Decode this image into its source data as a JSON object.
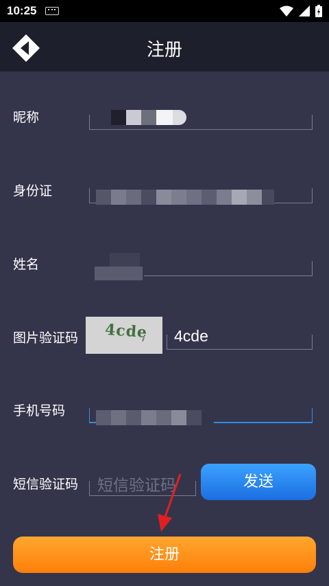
{
  "status_bar": {
    "time": "10:25",
    "icons": [
      "keyboard-icon",
      "wifi-icon",
      "signal-icon",
      "battery-icon"
    ]
  },
  "header": {
    "title": "注册",
    "back_icon": "back-arrow-icon"
  },
  "form": {
    "nickname": {
      "label": "昵称"
    },
    "id_card": {
      "label": "身份证"
    },
    "name": {
      "label": "姓名"
    },
    "captcha": {
      "label": "图片验证码",
      "image_text": "4cde",
      "value": "4cde"
    },
    "phone": {
      "label": "手机号码"
    },
    "sms_code": {
      "label": "短信验证码",
      "placeholder": "短信验证码"
    }
  },
  "buttons": {
    "send_label": "发送",
    "register_label": "注册"
  },
  "colors": {
    "background": "#34354b",
    "header": "#1e1f2c",
    "send_button": "#1c6ee0",
    "register_button": "#ff8a14",
    "annotation_arrow": "#e02020"
  }
}
